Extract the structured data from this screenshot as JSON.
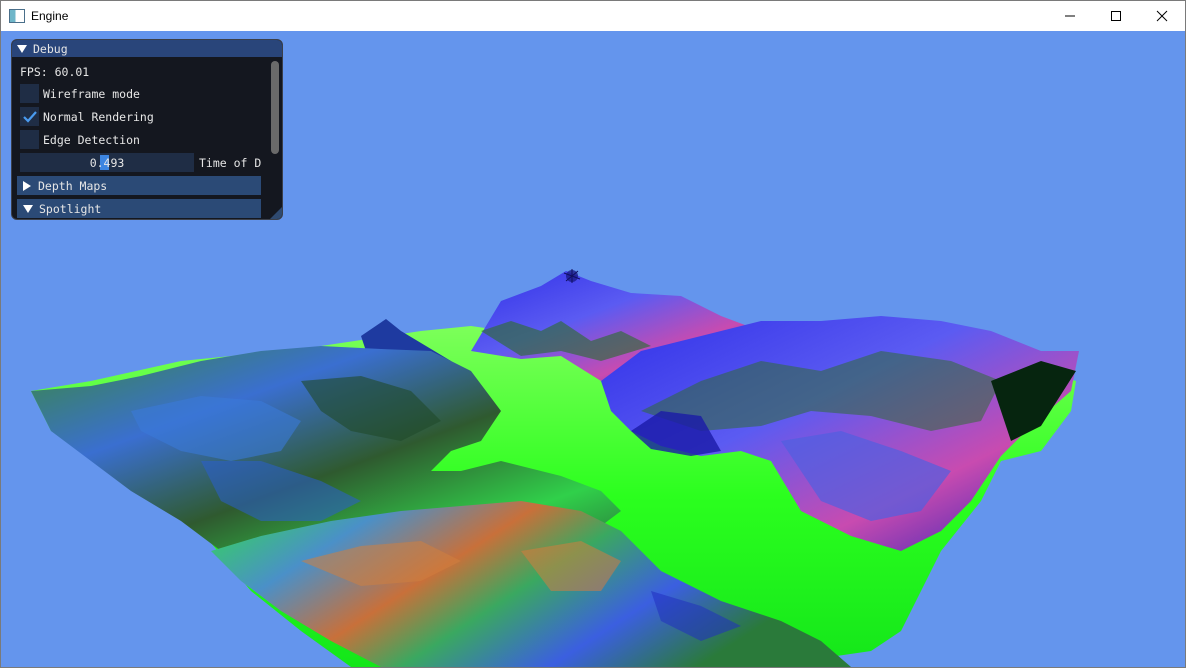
{
  "window": {
    "title": "Engine",
    "icon": "app-window-icon",
    "controls": [
      "minimize-icon",
      "maximize-icon",
      "close-icon"
    ]
  },
  "scene": {
    "background_color": "#6495ed",
    "terrain_palette": [
      "#00ff2a",
      "#2f6b35",
      "#2a2ad6",
      "#e0408a",
      "#d07a30"
    ]
  },
  "debug_panel": {
    "title": "Debug",
    "fps_label": "FPS: 60.01",
    "wireframe": {
      "label": "Wireframe mode",
      "checked": false
    },
    "normal_rendering": {
      "label": "Normal Rendering",
      "checked": true
    },
    "edge_detection": {
      "label": "Edge Detection",
      "checked": false
    },
    "time_slider": {
      "value": "0.493",
      "label": "Time of D"
    },
    "depth_maps": {
      "label": "Depth Maps",
      "expanded": false
    },
    "spotlight": {
      "label": "Spotlight",
      "expanded": true
    }
  }
}
